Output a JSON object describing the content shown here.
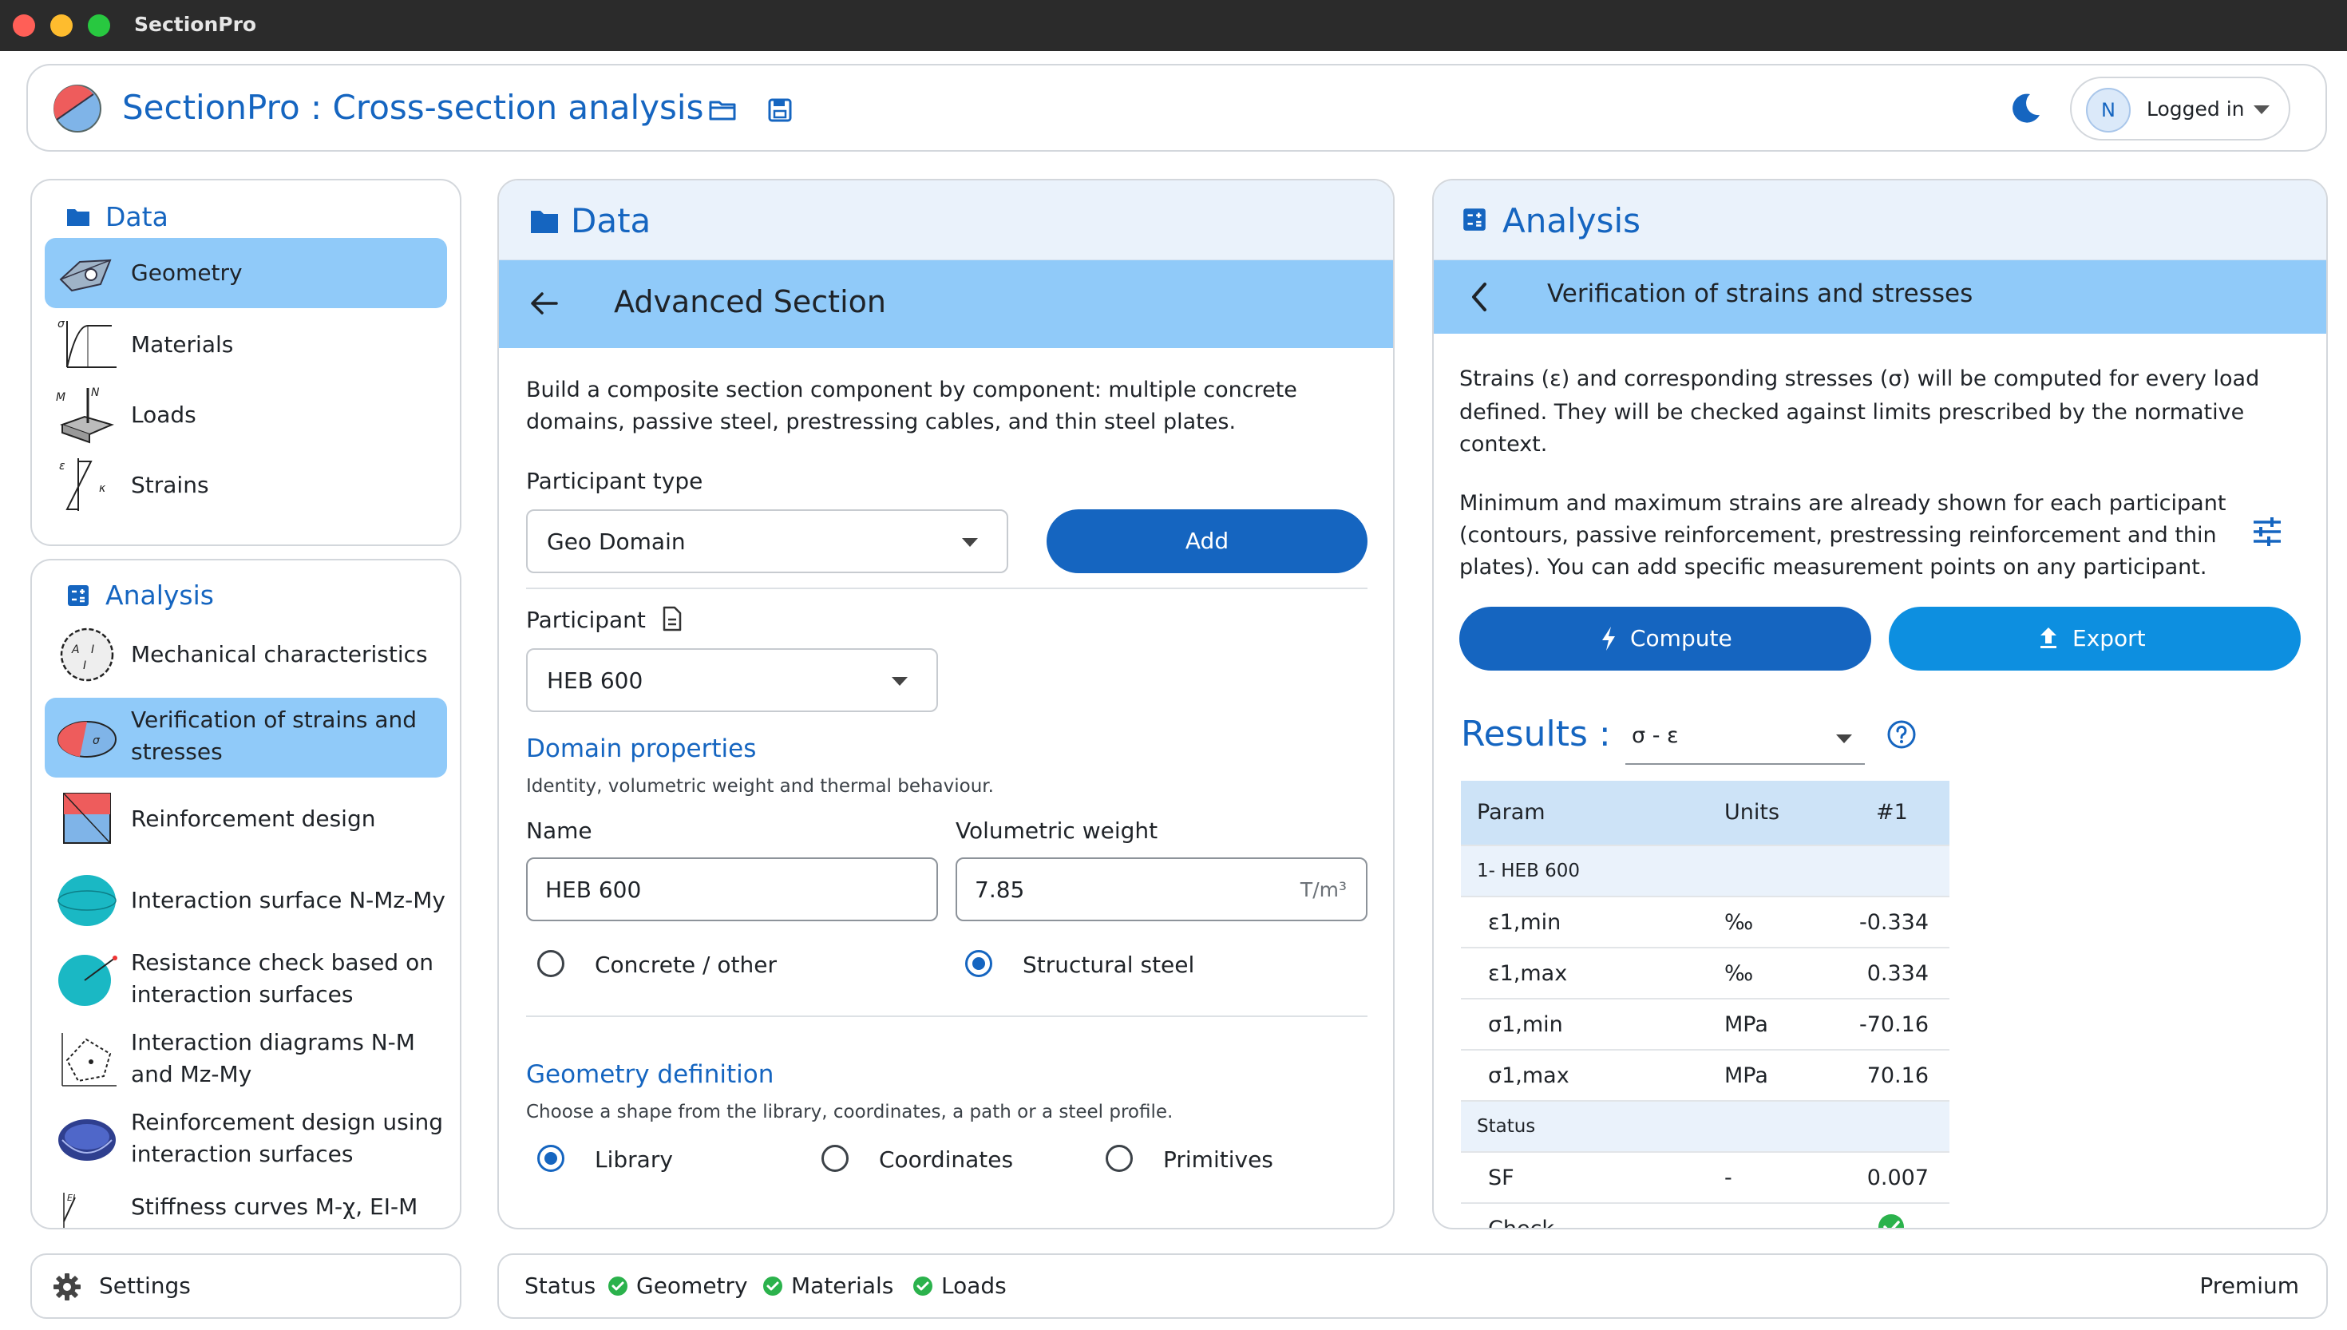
{
  "window": {
    "title": "SectionPro"
  },
  "header": {
    "title": "SectionPro : Cross-section analysis",
    "user_initial": "N",
    "user_label": "Logged in"
  },
  "sidebar": {
    "data_title": "Data",
    "data_items": [
      {
        "label": "Geometry",
        "active": true
      },
      {
        "label": "Materials"
      },
      {
        "label": "Loads"
      },
      {
        "label": "Strains"
      }
    ],
    "analysis_title": "Analysis",
    "analysis_items": [
      {
        "label": "Mechanical characteristics"
      },
      {
        "label_1": "Verification of strains and",
        "label_2": "stresses",
        "active": true
      },
      {
        "label": "Reinforcement design"
      },
      {
        "label": "Interaction surface N-Mz-My"
      },
      {
        "label_1": "Resistance check based on",
        "label_2": "interaction surfaces"
      },
      {
        "label_1": "Interaction diagrams N-M",
        "label_2": "and Mz-My"
      },
      {
        "label_1": "Reinforcement design using",
        "label_2": "interaction surfaces"
      },
      {
        "label": "Stiffness curves M-χ, EI-M"
      }
    ],
    "settings_label": "Settings"
  },
  "center": {
    "title": "Data",
    "subtitle": "Advanced Section",
    "intro_1": "Build a composite section component by component: multiple concrete",
    "intro_2": "domains, passive steel, prestressing cables, and thin steel plates.",
    "participant_type_label": "Participant type",
    "participant_type_value": "Geo Domain",
    "add_button": "Add",
    "participant_label": "Participant",
    "participant_value": "HEB 600",
    "domain_title": "Domain properties",
    "domain_desc": "Identity, volumetric weight and thermal behaviour.",
    "name_label": "Name",
    "name_value": "HEB 600",
    "weight_label": "Volumetric weight",
    "weight_value": "7.85",
    "weight_unit": "T/m³",
    "material_options": [
      {
        "label": "Concrete / other",
        "selected": false
      },
      {
        "label": "Structural steel",
        "selected": true
      }
    ],
    "geometry_title": "Geometry definition",
    "geometry_desc": "Choose a shape from the library, coordinates, a path or a steel profile.",
    "geometry_options": [
      {
        "label": "Library",
        "selected": true
      },
      {
        "label": "Coordinates",
        "selected": false
      },
      {
        "label": "Primitives",
        "selected": false
      }
    ]
  },
  "right": {
    "title": "Analysis",
    "subtitle": "Verification of strains and stresses",
    "para1_1": "Strains (ε) and corresponding stresses (σ) will be computed for every load",
    "para1_2": "defined. They will be checked against limits prescribed by the normative",
    "para1_3": "context.",
    "para2_1": "Minimum and maximum strains are already shown for each participant",
    "para2_2": "(contours, passive reinforcement, prestressing reinforcement and thin",
    "para2_3": "plates). You can add specific measurement points on any participant.",
    "compute_button": "Compute",
    "export_button": "Export",
    "results_label": "Results :",
    "results_select": "σ - ε",
    "table": {
      "headers": [
        "Param",
        "Units",
        "#1"
      ],
      "group1": "1- HEB 600",
      "rows": [
        {
          "param": "ε1,min",
          "units": "‰",
          "value": "-0.334"
        },
        {
          "param": "ε1,max",
          "units": "‰",
          "value": "0.334"
        },
        {
          "param": "σ1,min",
          "units": "MPa",
          "value": "-70.16"
        },
        {
          "param": "σ1,max",
          "units": "MPa",
          "value": "70.16"
        }
      ],
      "group2": "Status",
      "sf": {
        "param": "SF",
        "units": "-",
        "value": "0.007"
      },
      "check": {
        "param": "Check"
      }
    }
  },
  "status_bar": {
    "label": "Status",
    "items": [
      "Geometry",
      "Materials",
      "Loads"
    ],
    "plan": "Premium"
  },
  "colors": {
    "accent": "#1565c0",
    "active_bg": "#90caf9",
    "ok": "#2bb24c"
  }
}
